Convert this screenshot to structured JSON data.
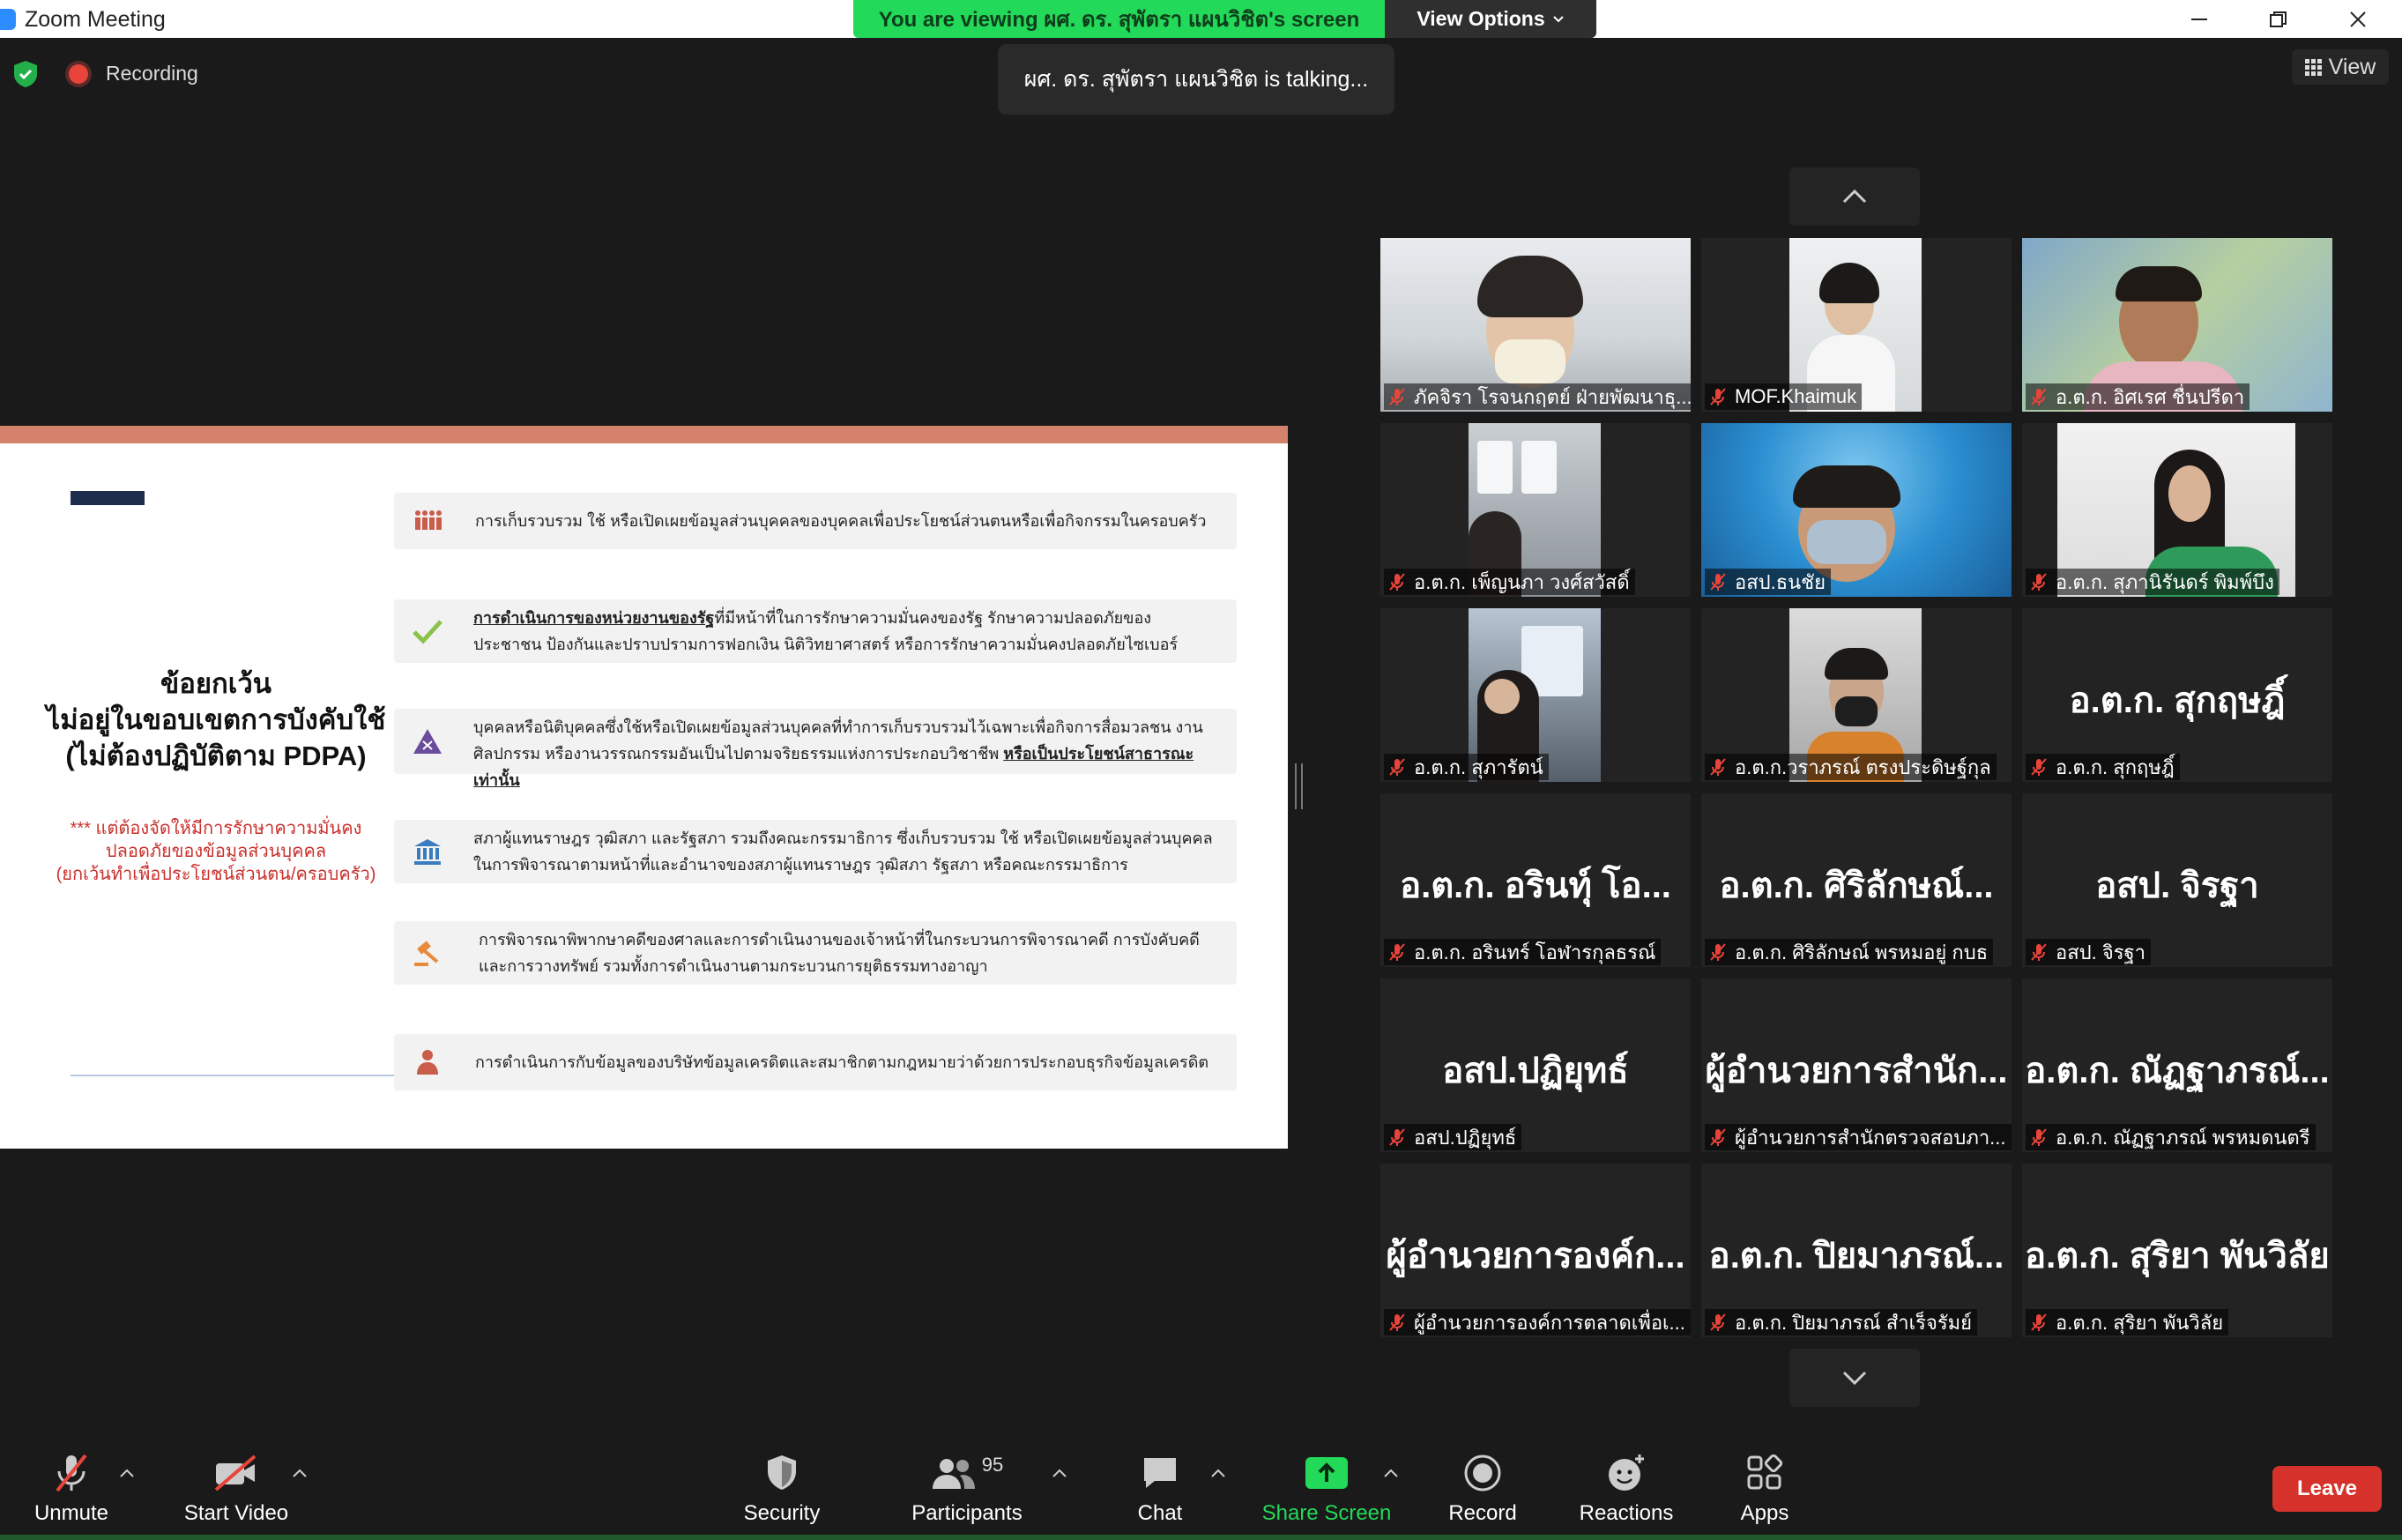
{
  "window": {
    "title": "Zoom Meeting",
    "viewing_banner": "You are viewing ผศ. ดร. สุพัตรา แผนวิชิต's screen",
    "view_options": "View Options"
  },
  "meeting": {
    "recording_label": "Recording",
    "talking": "ผศ. ดร. สุพัตรา แผนวิชิต is talking...",
    "view_label": "View"
  },
  "slide": {
    "heading_1": "ข้อยกเว้น",
    "heading_2": "ไม่อยู่ในขอบเขตการบังคับใช้",
    "heading_3": "(ไม่ต้องปฏิบัติตาม PDPA)",
    "note_1": "*** แต่ต้องจัดให้มีการรักษาความมั่นคง",
    "note_2": "ปลอดภัยของข้อมูลส่วนบุคคล",
    "note_3": "(ยกเว้นทำเพื่อประโยชน์ส่วนตน/ครอบครัว)",
    "rows": [
      {
        "text": "การเก็บรวบรวม ใช้ หรือเปิดเผยข้อมูลส่วนบุคคลของบุคคลเพื่อประโยชน์ส่วนตนหรือเพื่อกิจกรรมในครอบครัว"
      },
      {
        "bold": "การดำเนินการของหน่วยงานของรัฐ",
        "text": "ที่มีหน้าที่ในการรักษาความมั่นคงของรัฐ รักษาความปลอดภัยของประชาชน ป้องกันและปราบปรามการฟอกเงิน นิติวิทยาศาสตร์ หรือการรักษาความมั่นคงปลอดภัยไซเบอร์"
      },
      {
        "text": "บุคคลหรือนิติบุคคลซึ่งใช้หรือเปิดเผยข้อมูลส่วนบุคคลที่ทำการเก็บรวบรวมไว้เฉพาะเพื่อกิจการสื่อมวลชน งานศิลปกรรม หรืองานวรรณกรรมอันเป็นไปตามจริยธรรมแห่งการประกอบวิชาชีพ ",
        "bold": "หรือเป็นประโยชน์สาธารณะเท่านั้น"
      },
      {
        "text": "สภาผู้แทนราษฎร วุฒิสภา และรัฐสภา รวมถึงคณะกรรมาธิการ ซึ่งเก็บรวบรวม ใช้ หรือเปิดเผยข้อมูลส่วนบุคคลในการพิจารณาตามหน้าที่และอำนาจของสภาผู้แทนราษฎร วุฒิสภา รัฐสภา หรือคณะกรรมาธิการ"
      },
      {
        "text": "การพิจารณาพิพากษาคดีของศาลและการดำเนินงานของเจ้าหน้าที่ในกระบวนการพิจารณาคดี การบังคับคดี และการวางทรัพย์ รวมทั้งการดำเนินงานตามกระบวนการยุติธรรมทางอาญา"
      },
      {
        "text": "การดำเนินการกับข้อมูลของบริษัทข้อมูลเครดิตและสมาชิกตามกฎหมายว่าด้วยการประกอบธุรกิจข้อมูลเครดิต"
      }
    ]
  },
  "participants": [
    {
      "name": "ภัคจิรา โรจนกฤตย์ ฝ่ายพัฒนาธุ...",
      "video": true
    },
    {
      "name": "MOF.Khaimuk",
      "video": true
    },
    {
      "name": "อ.ต.ก. อิศเรศ ชื่นปรีดา",
      "video": true
    },
    {
      "name": "อ.ต.ก. เพ็ญนภา วงศ์สวัสดิ์",
      "video": true
    },
    {
      "name": "อสป.ธนชัย",
      "video": true
    },
    {
      "name": "อ.ต.ก.  สุภานิรันดร์ พิมพ์บึง",
      "video": true
    },
    {
      "name": "อ.ต.ก. สุภารัตน์",
      "video": true
    },
    {
      "name": "อ.ต.ก.วราภรณ์ ตรงประดิษฐ์กุล",
      "video": true
    },
    {
      "name": "อ.ต.ก. สุกฤษฎิ์",
      "big": "อ.ต.ก. สุกฤษฎิ์",
      "video": false
    },
    {
      "name": "อ.ต.ก. อรินทร์ โอฬารกุลธรณ์",
      "big": "อ.ต.ก. อรินทุ์ โอ...",
      "video": false
    },
    {
      "name": "อ.ต.ก. ศิริลักษณ์ พรหมอยู่ กบธ",
      "big": "อ.ต.ก. ศิริลักษณ์...",
      "video": false
    },
    {
      "name": "อสป. จิรฐา",
      "big": "อสป. จิรฐา",
      "video": false
    },
    {
      "name": "อสป.ปฏิยุทธ์",
      "big": "อสป.ปฏิยุทธ์",
      "video": false
    },
    {
      "name": "ผู้อำนวยการสำนักตรวจสอบภา...",
      "big": "ผู้อำนวยการสำนัก...",
      "video": false
    },
    {
      "name": "อ.ต.ก. ณัฏฐาภรณ์ พรหมดนตรี",
      "big": "อ.ต.ก. ณัฏฐาภรณ์...",
      "video": false
    },
    {
      "name": "ผู้อำนวยการองค์การตลาดเพื่อเ...",
      "big": "ผู้อำนวยการองค์ก...",
      "video": false
    },
    {
      "name": "อ.ต.ก. ปิยมาภรณ์ สำเร็จรัมย์",
      "big": "อ.ต.ก. ปิยมาภรณ์...",
      "video": false
    },
    {
      "name": "อ.ต.ก. สุริยา พันวิลัย",
      "big": "อ.ต.ก. สุริยา พันวิลัย",
      "video": false
    }
  ],
  "toolbar": {
    "unmute": "Unmute",
    "start_video": "Start Video",
    "security": "Security",
    "participants": "Participants",
    "participants_count": "95",
    "chat": "Chat",
    "share_screen": "Share Screen",
    "record": "Record",
    "reactions": "Reactions",
    "apps": "Apps",
    "leave": "Leave"
  },
  "colors": {
    "share_green": "#23d959",
    "leave_red": "#d6322b",
    "mute_red": "#e8443a",
    "slide_accent": "#d4826b"
  }
}
